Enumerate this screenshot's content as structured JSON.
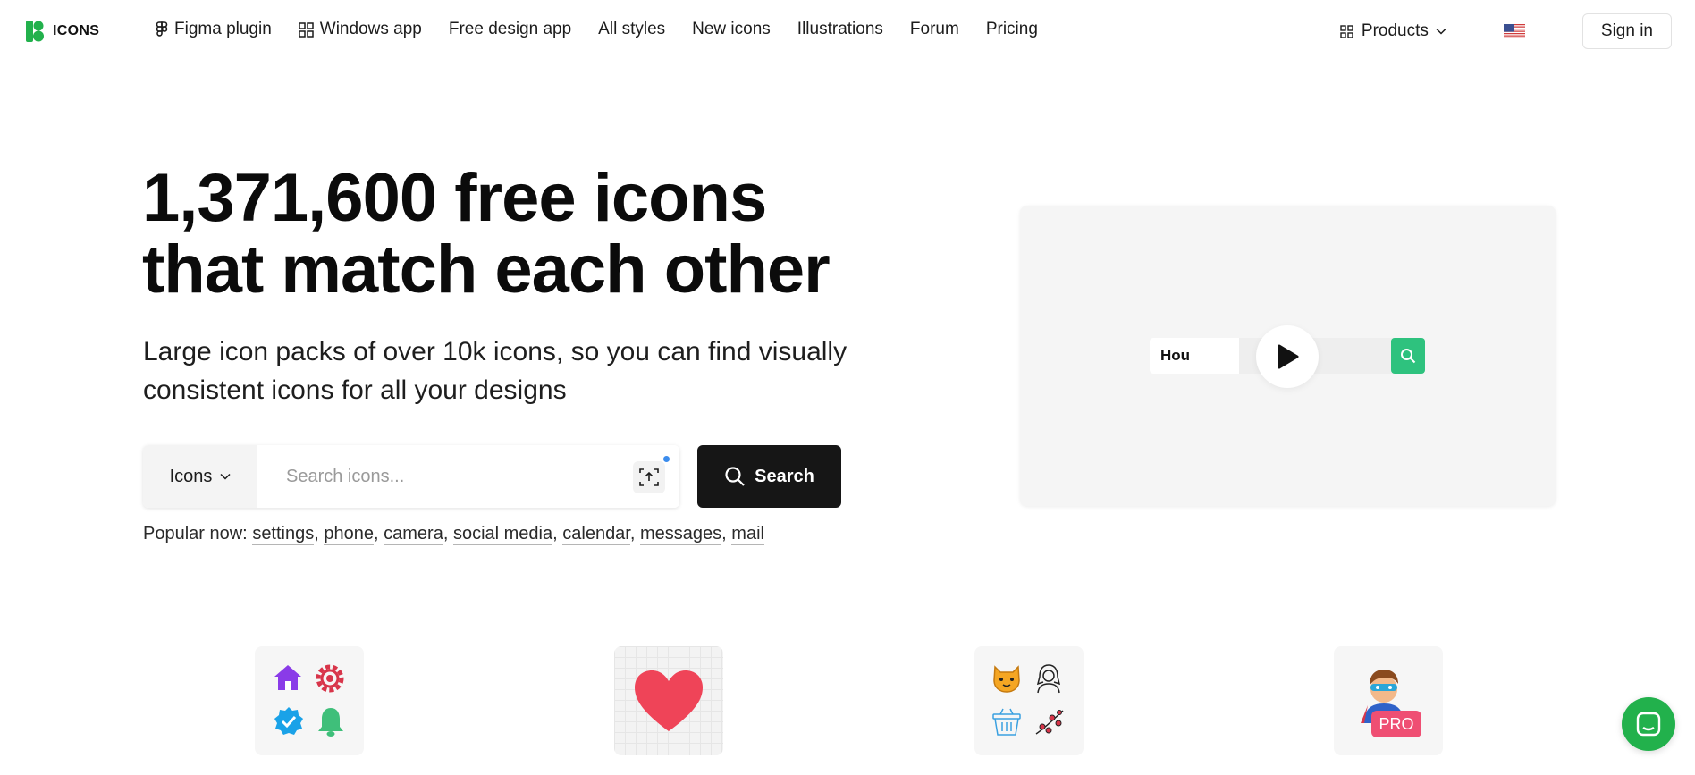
{
  "brand": {
    "name": "ICONS",
    "accent_color": "#22b14c"
  },
  "nav": {
    "links": [
      {
        "label": "Figma plugin",
        "icon": "figma-icon"
      },
      {
        "label": "Windows app",
        "icon": "windows-icon"
      },
      {
        "label": "Free design app"
      },
      {
        "label": "All styles"
      },
      {
        "label": "New icons"
      },
      {
        "label": "Illustrations"
      },
      {
        "label": "Forum"
      },
      {
        "label": "Pricing"
      }
    ],
    "products_label": "Products",
    "flag": "us-flag-icon",
    "signin_label": "Sign in"
  },
  "hero": {
    "title": "1,371,600 free icons that match each other",
    "subtitle": "Large icon packs of over 10k icons, so you can find visually consistent icons for all your designs"
  },
  "search": {
    "type_label": "Icons",
    "placeholder": "Search icons...",
    "button_label": "Search"
  },
  "popular": {
    "label": "Popular now:",
    "terms": [
      "settings",
      "phone",
      "camera",
      "social media",
      "calendar",
      "messages",
      "mail"
    ]
  },
  "demo": {
    "typed_text": "Hou",
    "search_color": "#2ec27e"
  },
  "tiles": [
    {
      "name": "color-icons-tile",
      "icons": [
        "house-icon",
        "gear-icon",
        "verified-badge-icon",
        "bell-icon"
      ]
    },
    {
      "name": "heart-tile",
      "icons": [
        "heart-icon"
      ]
    },
    {
      "name": "line-icons-tile",
      "icons": [
        "cat-emoji-icon",
        "woman-line-icon",
        "basket-icon",
        "branch-icon"
      ]
    },
    {
      "name": "pro-tile",
      "icons": [
        "superhero-icon"
      ],
      "badge": "PRO"
    }
  ]
}
